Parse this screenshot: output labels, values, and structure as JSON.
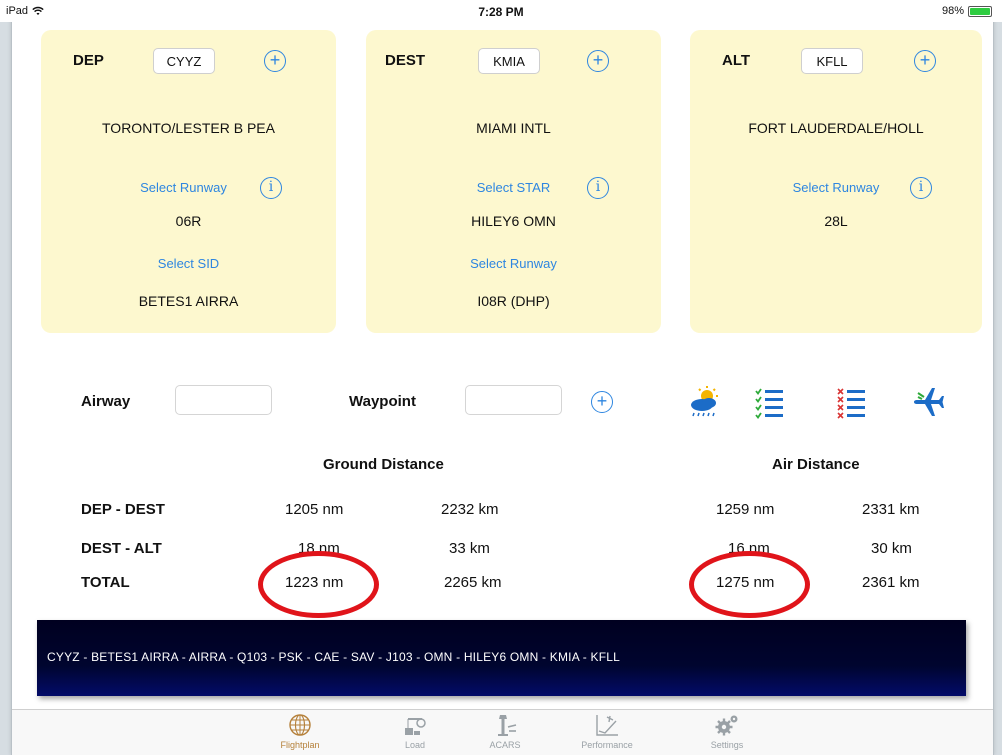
{
  "status_bar": {
    "device": "iPad",
    "time": "7:28 PM",
    "battery": "98%",
    "battery_level": 0.98
  },
  "cards": [
    {
      "label": "DEP",
      "code": "CYYZ",
      "name": "TORONTO/LESTER B PEA",
      "link1": "Select Runway",
      "value1": "06R",
      "link2": "Select SID",
      "value2": "BETES1 AIRRA"
    },
    {
      "label": "DEST",
      "code": "KMIA",
      "name": "MIAMI INTL",
      "link1": "Select STAR",
      "value1": "HILEY6 OMN",
      "link2": "Select Runway",
      "value2": "I08R (DHP)"
    },
    {
      "label": "ALT",
      "code": "KFLL",
      "name": "FORT LAUDERDALE/HOLL",
      "link1": "Select Runway",
      "value1": "28L"
    }
  ],
  "route_entry": {
    "airway_label": "Airway",
    "airway_value": "",
    "waypoint_label": "Waypoint",
    "waypoint_value": ""
  },
  "distances": {
    "ground_heading": "Ground Distance",
    "air_heading": "Air Distance",
    "rows": [
      {
        "label": "DEP - DEST",
        "ground_nm": "1205 nm",
        "ground_km": "2232 km",
        "air_nm": "1259 nm",
        "air_km": "2331 km"
      },
      {
        "label": "DEST - ALT",
        "ground_nm": "18 nm",
        "ground_km": "33 km",
        "air_nm": "16 nm",
        "air_km": "30 km"
      },
      {
        "label": "TOTAL",
        "ground_nm": "1223 nm",
        "ground_km": "2265 km",
        "air_nm": "1275 nm",
        "air_km": "2361 km"
      }
    ]
  },
  "route_string": "CYYZ - BETES1 AIRRA - AIRRA - Q103 - PSK - CAE - SAV - J103 - OMN - HILEY6 OMN - KMIA - KFLL",
  "tabs": [
    {
      "label": "Flightplan",
      "icon": "globe-icon"
    },
    {
      "label": "Load",
      "icon": "load-icon"
    },
    {
      "label": "ACARS",
      "icon": "acars-tower-icon"
    },
    {
      "label": "Performance",
      "icon": "performance-chart-icon"
    },
    {
      "label": "Settings",
      "icon": "gears-icon"
    }
  ],
  "colors": {
    "accent": "#2e86e0",
    "card_bg": "#fdf8cf",
    "highlight": "#e0141a",
    "active_tab": "#b5803a"
  }
}
